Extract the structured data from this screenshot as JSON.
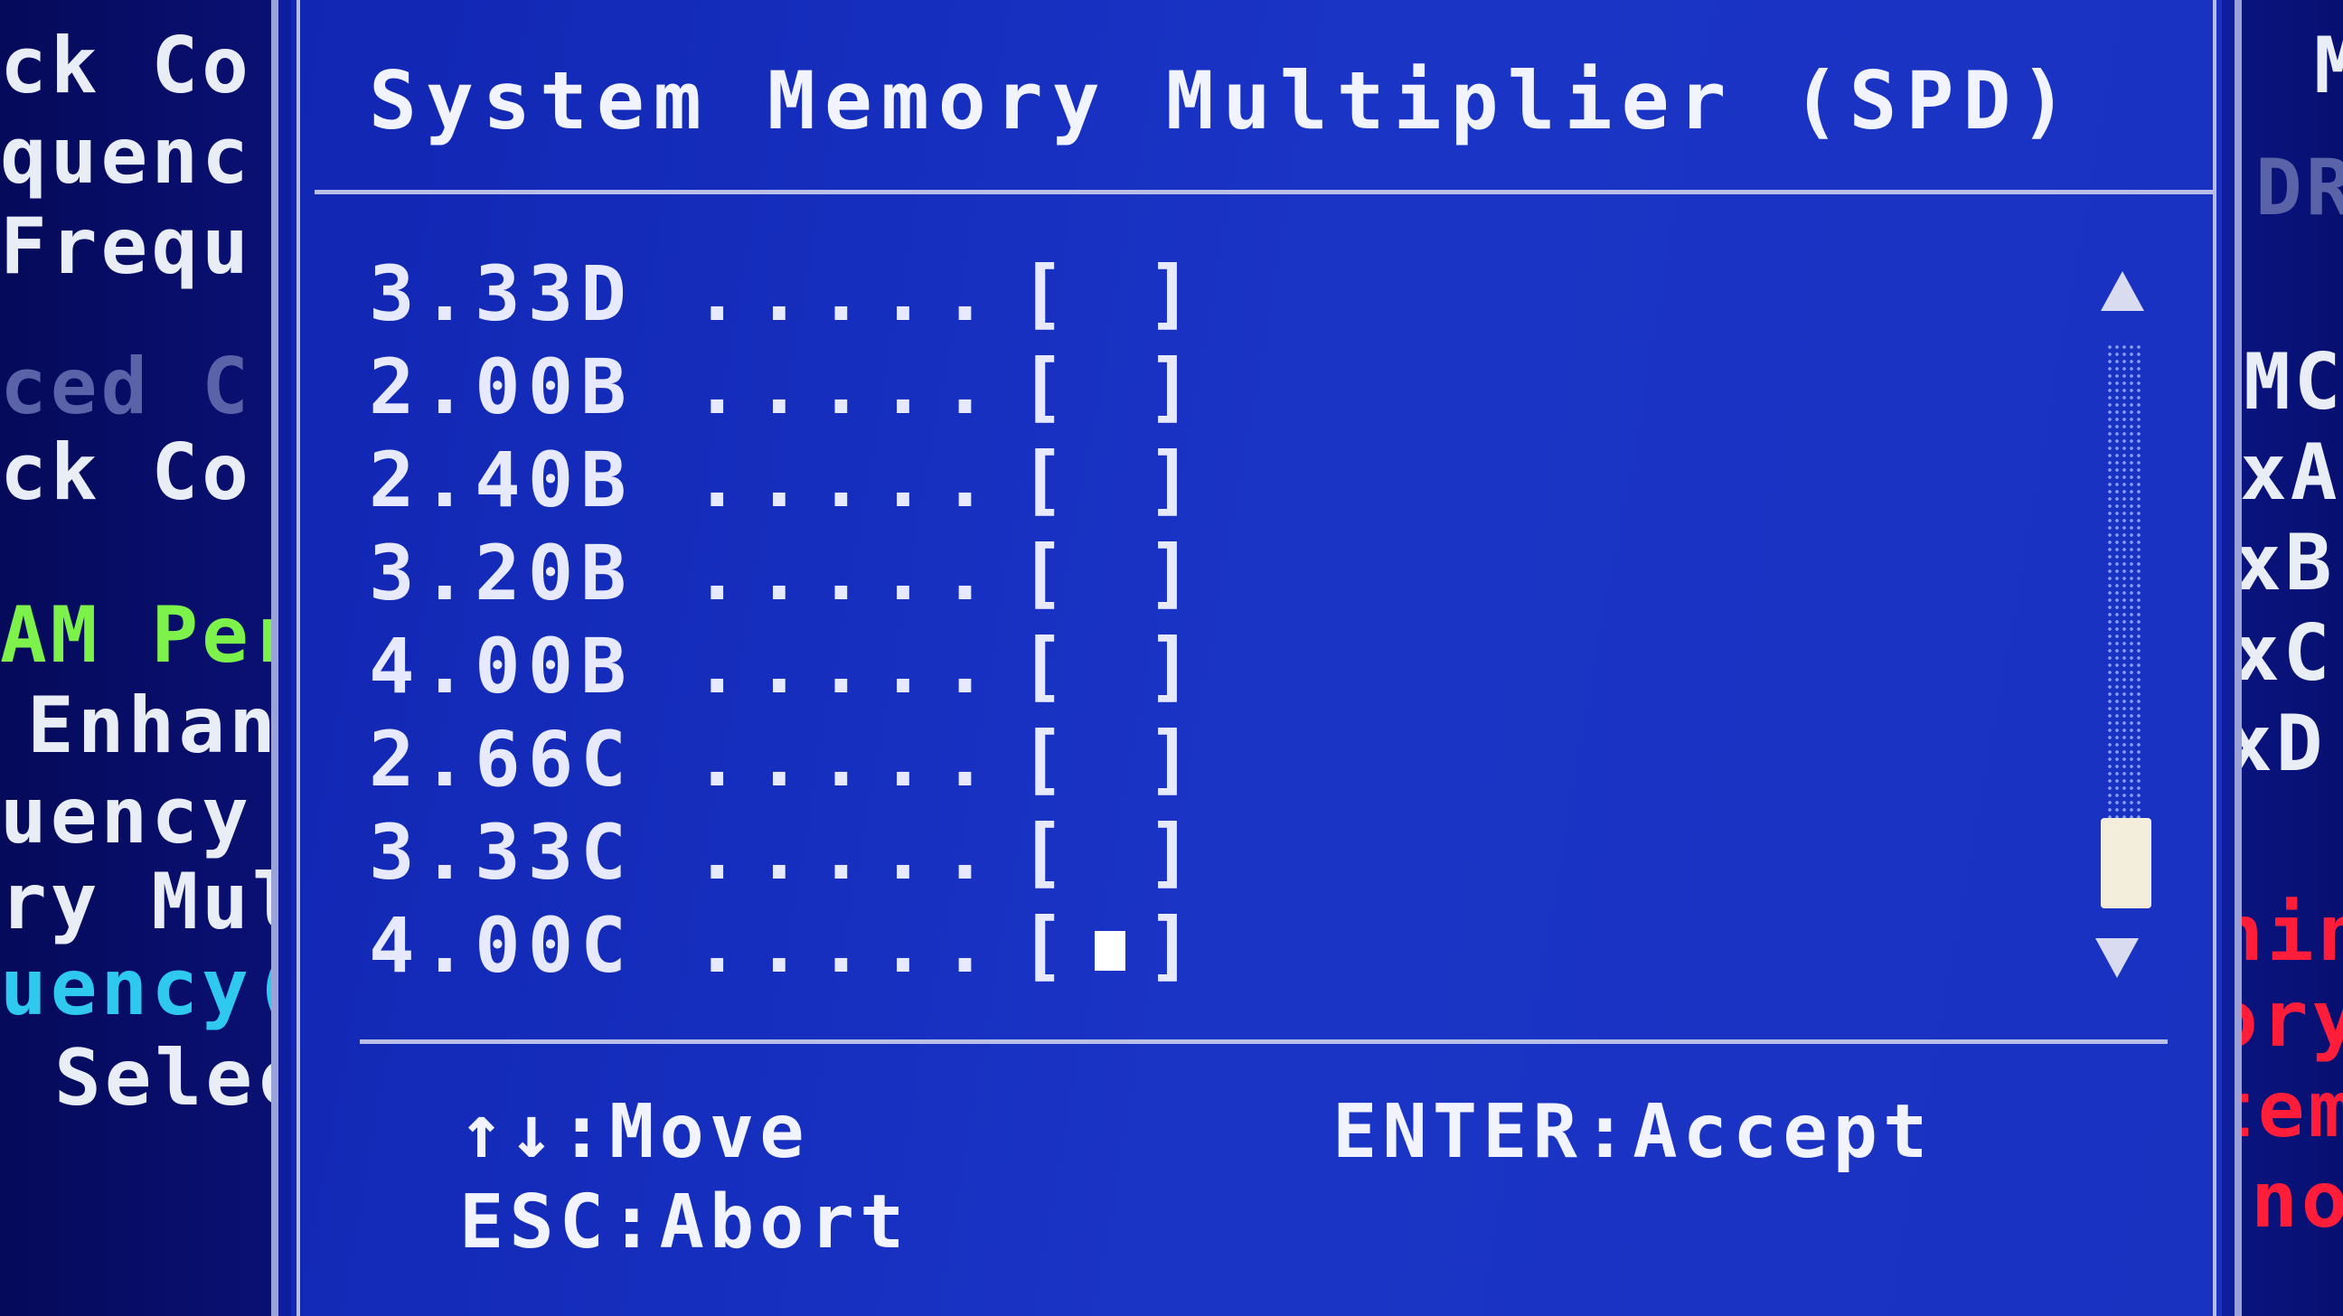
{
  "background": {
    "left_lines": [
      {
        "text": "ck Co",
        "tone": "normal"
      },
      {
        "text": "quenc",
        "tone": "normal"
      },
      {
        "text": "Frequ",
        "tone": "normal"
      },
      {
        "text": "ced C",
        "tone": "dim"
      },
      {
        "text": "ck Co",
        "tone": "normal"
      },
      {
        "text": "AM Per",
        "tone": "green"
      },
      {
        "text": "Enhan",
        "tone": "normal"
      },
      {
        "text": "uency",
        "tone": "normal"
      },
      {
        "text": "ry Mul",
        "tone": "normal"
      },
      {
        "text": "uency(",
        "tone": "cyan"
      },
      {
        "text": "Selec",
        "tone": "normal"
      }
    ],
    "right_lines": [
      {
        "text": "M",
        "tone": "normal"
      },
      {
        "text": "DR",
        "tone": "dim"
      },
      {
        "text": "MC",
        "tone": "normal"
      },
      {
        "text": "xA",
        "tone": "normal"
      },
      {
        "text": "xB",
        "tone": "normal"
      },
      {
        "text": "xC",
        "tone": "normal"
      },
      {
        "text": "xD",
        "tone": "normal"
      },
      {
        "text": "nin",
        "tone": "red"
      },
      {
        "text": "ory",
        "tone": "red"
      },
      {
        "text": "tem",
        "tone": "red"
      },
      {
        "text": "no",
        "tone": "red"
      }
    ]
  },
  "dialog": {
    "title": "System Memory Multiplier (SPD)",
    "options": [
      {
        "value": "3.33D",
        "dots": ".....",
        "selected": false
      },
      {
        "value": "2.00B",
        "dots": ".....",
        "selected": false
      },
      {
        "value": "2.40B",
        "dots": ".....",
        "selected": false
      },
      {
        "value": "3.20B",
        "dots": ".....",
        "selected": false
      },
      {
        "value": "4.00B",
        "dots": ".....",
        "selected": false
      },
      {
        "value": "2.66C",
        "dots": ".....",
        "selected": false
      },
      {
        "value": "3.33C",
        "dots": ".....",
        "selected": false
      },
      {
        "value": "4.00C",
        "dots": ".....",
        "selected": true
      }
    ],
    "help": {
      "move": "↑↓:Move",
      "accept": "ENTER:Accept",
      "abort": "ESC:Abort"
    }
  },
  "colors": {
    "dialog_bg": "#1a32c0",
    "text": "#e7eaff",
    "highlight_green": "#7cf24a",
    "highlight_cyan": "#2fc8ee",
    "highlight_red": "#ff1d3a"
  }
}
